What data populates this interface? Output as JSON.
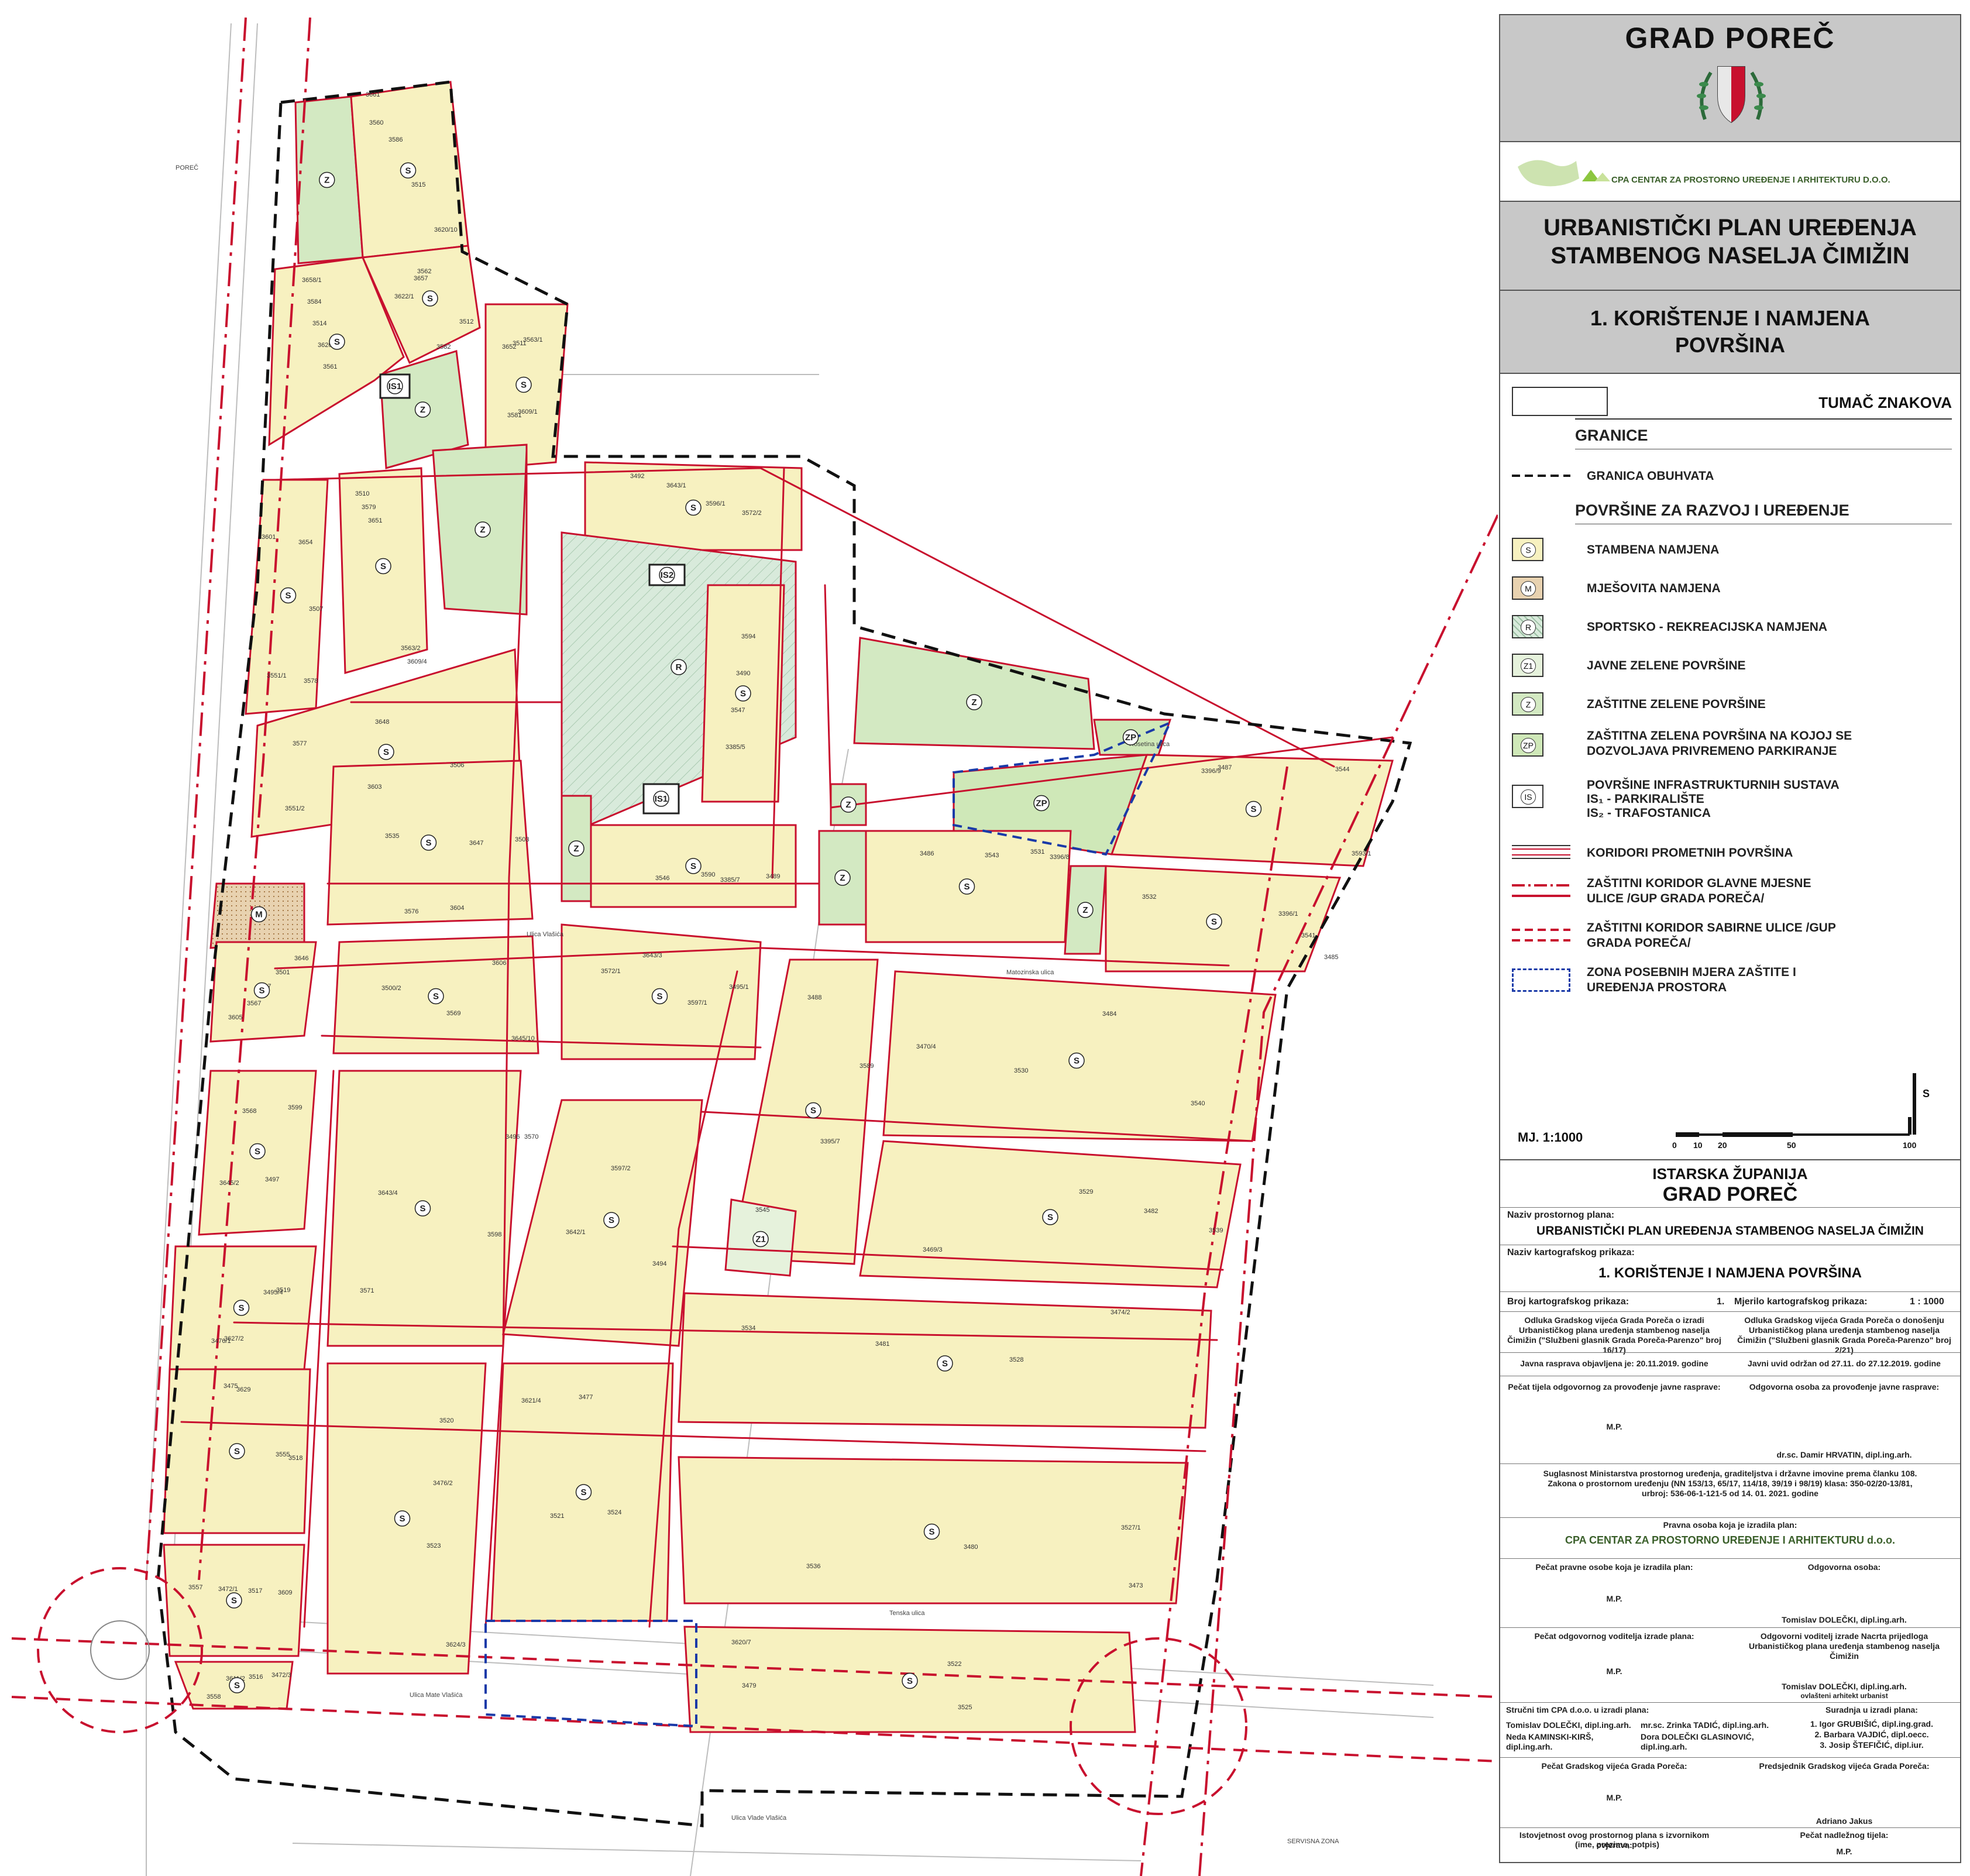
{
  "colors": {
    "stambena": "#f7f1c0",
    "mjesovita": "#e8d2b0",
    "sportska": "#d8eadb",
    "javne_zelene": "#e6f2dc",
    "zastitne_zelene": "#d3e9c2",
    "zp": "#cfe8b8",
    "red_corridor": "#c8102e",
    "blue_zone": "#1a3aa8",
    "header_gray": "#c8c8c8"
  },
  "header": {
    "city": "GRAD POREČ",
    "cpa_logo_text": "CPA CENTAR ZA PROSTORNO UREĐENJE I ARHITEKTURU D.O.O.",
    "plan_title_1": "URBANISTIČKI PLAN UREĐENJA",
    "plan_title_2": "STAMBENOG NASELJA ČIMIŽIN",
    "map_title_1": "1. KORIŠTENJE I NAMJENA",
    "map_title_2": "POVRŠINA"
  },
  "legend": {
    "title": "TUMAČ ZNAKOVA",
    "sections": {
      "granice": "GRANICE",
      "povrsine": "POVRŠINE ZA RAZVOJ I UREĐENJE"
    },
    "items": [
      {
        "code": "",
        "label": "GRANICA OBUHVATA",
        "kind": "dashed-black"
      },
      {
        "code": "S",
        "label": "STAMBENA NAMJENA",
        "kind": "fill-stambena"
      },
      {
        "code": "M",
        "label": "MJEŠOVITA NAMJENA",
        "kind": "fill-mjesovita"
      },
      {
        "code": "R",
        "label": "SPORTSKO - REKREACIJSKA NAMJENA",
        "kind": "fill-sportska"
      },
      {
        "code": "Z1",
        "label": "JAVNE ZELENE POVRŠINE",
        "kind": "fill-javne"
      },
      {
        "code": "Z",
        "label": "ZAŠTITNE ZELENE POVRŠINE",
        "kind": "fill-zastitne"
      },
      {
        "code": "ZP",
        "label": "ZAŠTITNA ZELENA POVRŠINA NA KOJOJ SE DOZVOLJAVA PRIVREMENO PARKIRANJE",
        "kind": "fill-zp"
      },
      {
        "code": "IS",
        "label": "POVRŠINE INFRASTRUKTURNIH SUSTAVA",
        "sub1": "IS₁ - PARKIRALIŠTE",
        "sub2": "IS₂ - TRAFOSTANICA",
        "kind": "fill-is"
      },
      {
        "code": "",
        "label": "KORIDORI PROMETNIH POVRŠINA",
        "kind": "road"
      },
      {
        "code": "",
        "label": "ZAŠTITNI KORIDOR GLAVNE MJESNE ULICE /GUP GRADA POREČA/",
        "kind": "dashdot-red"
      },
      {
        "code": "",
        "label": "ZAŠTITNI KORIDOR SABIRNE ULICE /GUP GRADA POREČA/",
        "kind": "dashed-red"
      },
      {
        "code": "",
        "label": "ZONA POSEBNIH MJERA ZAŠTITE I UREĐENJA PROSTORA",
        "kind": "dashed-blue"
      }
    ]
  },
  "scale": {
    "label": "MJ. 1:1000",
    "north": "S",
    "ticks": [
      "0",
      "10",
      "20",
      "50",
      "100"
    ]
  },
  "title_block": {
    "county": "ISTARSKA ŽUPANIJA",
    "city": "GRAD POREČ",
    "plan_name_label": "Naziv prostornog plana:",
    "plan_name": "URBANISTIČKI PLAN UREĐENJA STAMBENOG NASELJA ČIMIŽIN",
    "map_name_label": "Naziv kartografskog prikaza:",
    "map_name": "1. KORIŠTENJE I NAMJENA POVRŠINA",
    "map_number_label": "Broj kartografskog prikaza:",
    "map_number": "1.",
    "map_scale_label": "Mjerilo kartografskog prikaza:",
    "map_scale": "1 : 1000",
    "decision_left": "Odluka Gradskog vijeća Grada Poreča o izradi Urbanističkog plana uređenja stambenog naselja Čimižin (\"Službeni glasnik Grada Poreča-Parenzo\" broj 16/17)",
    "decision_right": "Odluka Gradskog vijeća Grada Poreča o donošenju Urbanističkog plana uređenja stambenog naselja Čimižin (\"Službeni glasnik Grada Poreča-Parenzo\" broj 2/21)",
    "public_debate": "Javna rasprava objavljena je: 20.11.2019. godine",
    "public_view": "Javni uvid održan od 27.11. do 27.12.2019. godine",
    "stamp_left": "Pečat tijela odgovornog za provođenje javne rasprave:",
    "stamp_right": "Odgovorna osoba za provođenje javne rasprave:",
    "mp": "M.P.",
    "resp_person": "dr.sc. Damir HRVATIN, dipl.ing.arh.",
    "ministry": "Suglasnost Ministarstva prostornog uređenja, graditeljstva i državne imovine prema članku 108. Zakona o prostornom uređenju (NN 153/13, 65/17, 114/18, 39/19 i 98/19) klasa: 350-02/20-13/81, urbroj: 536-06-1-121-5 od 14. 01. 2021. godine",
    "legal_person_label": "Pravna osoba koja je izradila plan:",
    "legal_person": "CPA CENTAR ZA PROSTORNO UREĐENJE I ARHITEKTURU d.o.o.",
    "stamp_legal": "Pečat pravne osobe koja je izradila plan:",
    "resp_legal": "Odgovorna osoba:",
    "resp_legal_name": "Tomislav DOLEČKI, dipl.ing.arh.",
    "stamp_leader": "Pečat odgovornog voditelja izrade plana:",
    "leader_title": "Odgovorni voditelj izrade Nacrta prijedloga Urbanističkog plana uređenja stambenog naselja Čimižin",
    "leader_name": "Tomislav DOLEČKI, dipl.ing.arh.",
    "leader_role": "ovlašteni arhitekt urbanist",
    "team_label": "Stručni tim CPA d.o.o. u izradi plana:",
    "team": [
      "Tomislav DOLEČKI, dipl.ing.arh.",
      "mr.sc. Zrinka TADIĆ, dipl.ing.arh.",
      "Neda KAMINSKI-KIRŠ, dipl.ing.arh.",
      "Dora DOLEČKI GLASINOVIĆ, dipl.ing.arh."
    ],
    "collab_label": "Suradnja u izradi plana:",
    "collab": [
      "1. Igor GRUBIŠIĆ, dipl.ing.grad.",
      "2. Barbara VAJDIĆ, dipl.oecc.",
      "3. Josip ŠTEFIČIĆ, dipl.iur."
    ],
    "council_stamp": "Pečat Gradskog vijeća Grada Poreča:",
    "council_president": "Predsjednik Gradskog vijeća Grada Poreča:",
    "president_name": "Adriano Jakus",
    "authenticity": "Istovjetnost ovog prostornog plana s izvornikom ovjerava:",
    "authority_stamp": "Pečat nadležnog tijela:",
    "signature": "(ime, prezime, potpis)"
  },
  "map": {
    "parcel_labels": [
      "3661",
      "3658/1",
      "3657",
      "3652",
      "3651",
      "3654",
      "3648",
      "3647",
      "3646",
      "3645/10",
      "3645/2",
      "3643/4",
      "3642/1",
      "3643/3",
      "3643/1",
      "3385/5",
      "3385/7",
      "3395/7",
      "3396/9",
      "3396/8",
      "3396/1",
      "3470/4",
      "3469/3",
      "3474/2",
      "3473",
      "3620/7",
      "3621/4",
      "3624/3",
      "3627/2",
      "3629",
      "3609",
      "3611/2",
      "3586",
      "3584",
      "3582",
      "3581",
      "3579",
      "3578",
      "3577",
      "3576",
      "3567",
      "3569",
      "3568",
      "3571",
      "3570",
      "3572/1",
      "3572/2",
      "3547",
      "3546",
      "3545",
      "3544",
      "3543",
      "3541",
      "3540",
      "3539",
      "3534",
      "3536",
      "3522",
      "3521",
      "3520",
      "3519",
      "3518",
      "3517",
      "3516",
      "3515",
      "3514",
      "3512",
      "3511",
      "3510",
      "3507",
      "3506",
      "3503",
      "3501",
      "3500/2",
      "3497",
      "3496",
      "3494",
      "3495/1",
      "3492",
      "3490",
      "3489",
      "3488",
      "3487",
      "3486",
      "3485",
      "3484",
      "3482",
      "3481",
      "3480",
      "3479",
      "3477",
      "3476/2",
      "3476/1",
      "3475",
      "3472/1",
      "3472/3",
      "3620/10",
      "3620/2",
      "3622/1",
      "3609/1",
      "3609/4",
      "3601",
      "3603",
      "3604",
      "3605",
      "3606",
      "3599",
      "3598",
      "3597/2",
      "3597/1",
      "3596/1",
      "3594",
      "3590",
      "3589",
      "3593/1",
      "3531",
      "3532",
      "3530",
      "3529",
      "3528",
      "3527/1",
      "3525",
      "3524",
      "3523",
      "3495/4",
      "3555",
      "3557",
      "3558",
      "3560",
      "3561",
      "3562",
      "3563/1",
      "3563/2",
      "3551/1",
      "3551/2",
      "3535",
      "3537"
    ],
    "streets": [
      "Ulica Mate Vlašića",
      "Ulica Vlade Vlašića",
      "Matozinska ulica",
      "Tenska ulica",
      "Rosetina ulica",
      "Ulica Vlašića",
      "SERVISNA ZONA",
      "POREČ"
    ],
    "zones": [
      {
        "code": "S"
      },
      {
        "code": "M"
      },
      {
        "code": "R"
      },
      {
        "code": "Z"
      },
      {
        "code": "Z1"
      },
      {
        "code": "ZP"
      },
      {
        "code": "IS1"
      },
      {
        "code": "IS2"
      }
    ]
  }
}
